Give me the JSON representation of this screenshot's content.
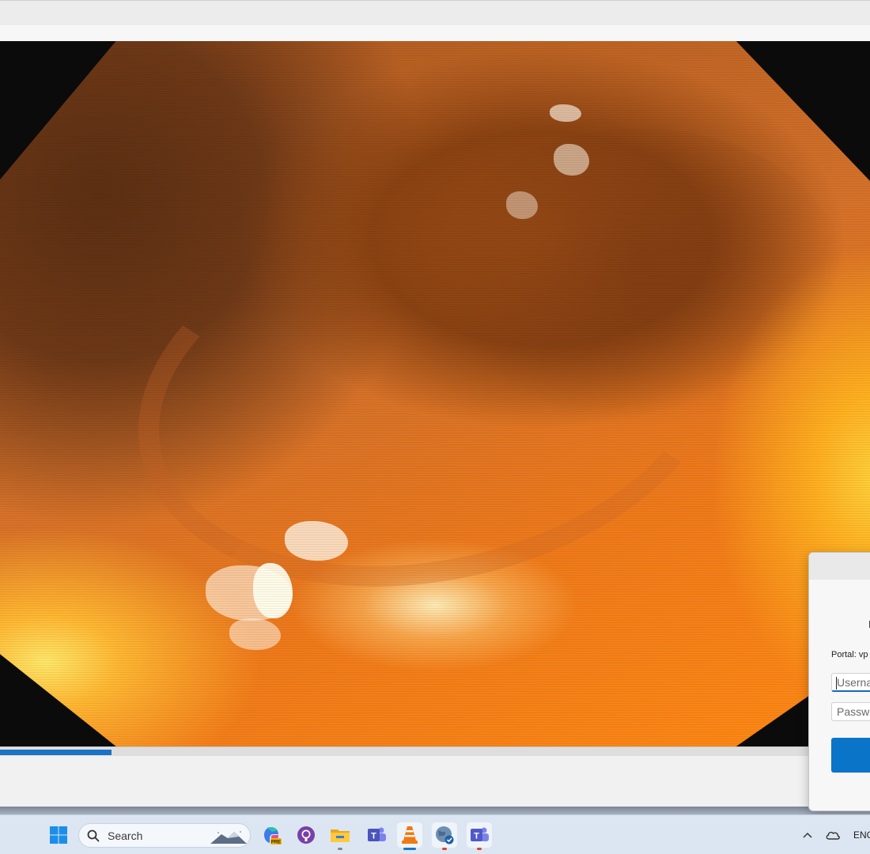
{
  "player": {
    "progress": 0.128
  },
  "vpn_dialog": {
    "portal_label": "Portal: vp",
    "username_placeholder": "Userna",
    "password_placeholder": "Passwo",
    "connect_label": ""
  },
  "taskbar": {
    "search_placeholder": "Search",
    "language": "ENG",
    "pinned": [
      "windows-start",
      "copilot-pre",
      "github-desktop",
      "file-explorer",
      "teams-classic",
      "vlc-media-player",
      "vpn-globe-client",
      "microsoft-teams"
    ]
  },
  "colors": {
    "accent": "#1a73c6",
    "connect_button": "#0a74c9",
    "taskbar": "#dce6f2"
  }
}
